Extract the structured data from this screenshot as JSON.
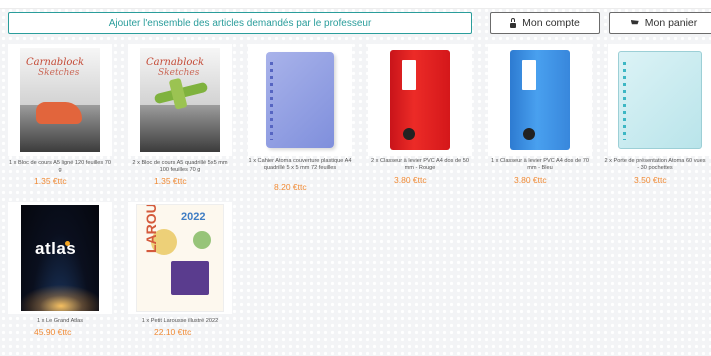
{
  "header": {
    "add_all_label": "Ajouter l'ensemble des articles demandés par le professeur",
    "account_label": "Mon compte",
    "cart_label": "Mon panier"
  },
  "products": [
    {
      "desc": "1 x Bloc de cours A5 ligné 120 feuilles 70 g",
      "price": "1.35 €ttc",
      "art": "notebook-shoes"
    },
    {
      "desc": "2 x Bloc de cours A5 quadrillé 5x5 mm 100 feuilles 70 g",
      "price": "1.35 €ttc",
      "art": "notebook-plane"
    },
    {
      "desc": "1 x Cahier Atoma couverture plastique A4 quadrillé 5 x 5 mm 72 feuilles",
      "price": "8.20 €ttc",
      "art": "blue-notebook"
    },
    {
      "desc": "2 x Classeur à levier PVC A4 dos de 50 mm - Rouge",
      "price": "3.80 €ttc",
      "art": "red-binder"
    },
    {
      "desc": "1 x Classeur à levier PVC A4 dos de 70 mm - Bleu",
      "price": "3.80 €ttc",
      "art": "blue-binder"
    },
    {
      "desc": "2 x Porte de présentation Atoma 60 vues - 30 pochettes",
      "price": "3.50 €ttc",
      "art": "presentation-folder"
    },
    {
      "desc": "1 x Le Grand Atlas",
      "price": "45.90 €ttc",
      "art": "atlas"
    },
    {
      "desc": "1 x Petit Larousse illustré 2022",
      "price": "22.10 €ttc",
      "art": "larousse"
    }
  ],
  "covers": {
    "notebook_title": "Carnablock",
    "notebook_subtitle": "Sketches",
    "atlas_title": "atlas",
    "larousse_year": "2022",
    "larousse_word": "LAROUSSE"
  },
  "colors": {
    "accent": "#2a9d9b",
    "price": "#f08a34"
  }
}
